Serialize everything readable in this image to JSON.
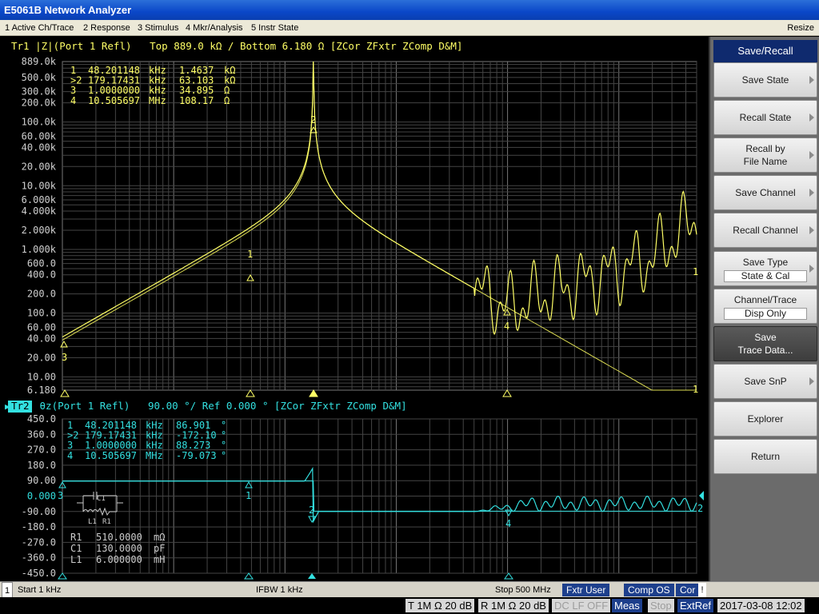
{
  "window": {
    "title": "E5061B Network Analyzer"
  },
  "menu": {
    "items": [
      "1 Active Ch/Trace",
      "2 Response",
      "3 Stimulus",
      "4 Mkr/Analysis",
      "5 Instr State"
    ],
    "resize": "Resize"
  },
  "trace1": {
    "id": "Tr1",
    "header_rest": " |Z|(Port 1 Refl)   Top 889.0 kΩ / Bottom 6.180 Ω [ZCor ZFxtr ZComp D&M]",
    "y_ticks": [
      "889.0k",
      "500.0k",
      "300.0k",
      "200.0k",
      "100.0k",
      "60.00k",
      "40.00k",
      "20.00k",
      "10.00k",
      "6.000k",
      "4.000k",
      "2.000k",
      "1.000k",
      "600.0",
      "400.0",
      "200.0",
      "100.0",
      "60.00",
      "40.00",
      "20.00",
      "10.00",
      "6.180"
    ],
    "markers": [
      {
        "sel": " ",
        "num": "1",
        "freq": "48.201148",
        "unit": "kHz",
        "val": "1.4637",
        "vunit": "kΩ"
      },
      {
        "sel": ">",
        "num": "2",
        "freq": "179.17431",
        "unit": "kHz",
        "val": "63.103",
        "vunit": "kΩ"
      },
      {
        "sel": " ",
        "num": "3",
        "freq": "1.0000000",
        "unit": "kHz",
        "val": "34.895",
        "vunit": "Ω"
      },
      {
        "sel": " ",
        "num": "4",
        "freq": "10.505697",
        "unit": "MHz",
        "val": "108.17",
        "vunit": "Ω"
      }
    ]
  },
  "trace2": {
    "id": "Tr2",
    "header_rest": " θz(Port 1 Refl)   90.00 °/ Ref 0.000 ° [ZCor ZFxtr ZComp D&M]",
    "y_ticks": [
      "450.0",
      "360.0",
      "270.0",
      "180.0",
      "90.00",
      "0.000",
      "-90.00",
      "-180.0",
      "-270.0",
      "-360.0",
      "-450.0"
    ],
    "markers": [
      {
        "sel": " ",
        "num": "1",
        "freq": "48.201148",
        "unit": "kHz",
        "val": "86.901",
        "vunit": "°"
      },
      {
        "sel": ">",
        "num": "2",
        "freq": "179.17431",
        "unit": "kHz",
        "val": "-172.10",
        "vunit": "°"
      },
      {
        "sel": " ",
        "num": "3",
        "freq": "1.0000000",
        "unit": "kHz",
        "val": "88.273",
        "vunit": "°"
      },
      {
        "sel": " ",
        "num": "4",
        "freq": "10.505697",
        "unit": "MHz",
        "val": "-79.073",
        "vunit": "°"
      }
    ],
    "circuit_labels": {
      "c": "C1",
      "l": "L1",
      "r": "R1"
    },
    "params": [
      {
        "name": "R1",
        "value": "510.0000",
        "unit": "mΩ"
      },
      {
        "name": "C1",
        "value": "130.0000",
        "unit": "pF"
      },
      {
        "name": "L1",
        "value": "6.000000",
        "unit": "mH"
      }
    ]
  },
  "softkeys": {
    "title": "Save/Recall",
    "keys": [
      {
        "label": "Save State",
        "arrow": true
      },
      {
        "label": "Recall State",
        "arrow": true
      },
      {
        "label": "Recall by\nFile Name",
        "arrow": true
      },
      {
        "label": "Save Channel",
        "arrow": true
      },
      {
        "label": "Recall Channel",
        "arrow": true
      },
      {
        "label": "Save Type",
        "value": "State & Cal",
        "arrow": true
      },
      {
        "label": "Channel/Trace",
        "value": "Disp Only",
        "arrow": false
      },
      {
        "label": "Save\nTrace Data...",
        "arrow": false,
        "selected": true
      },
      {
        "label": "Save SnP",
        "arrow": true
      },
      {
        "label": "Explorer",
        "arrow": false
      },
      {
        "label": "Return",
        "arrow": false
      }
    ]
  },
  "status": {
    "channel": "1",
    "start": "Start 1 kHz",
    "ifbw": "IFBW 1 kHz",
    "stop": "Stop 500 MHz",
    "fxtr": "Fxtr User",
    "comp": "Comp OS",
    "cor": "Cor",
    "excl": "!",
    "port_t": "T 1M Ω 20 dB",
    "port_r": "R 1M Ω 20 dB",
    "dclf": "DC LF OFF",
    "meas": "Meas",
    "stopbtn": "Stop",
    "extref": "ExtRef",
    "datetime": "2017-03-08 12:02"
  },
  "colors": {
    "trace1": "#ffff66",
    "trace2": "#33e0e0",
    "grid": "#5a5a5a",
    "background": "#000000",
    "softkey_title": "#0f2a6e"
  }
}
